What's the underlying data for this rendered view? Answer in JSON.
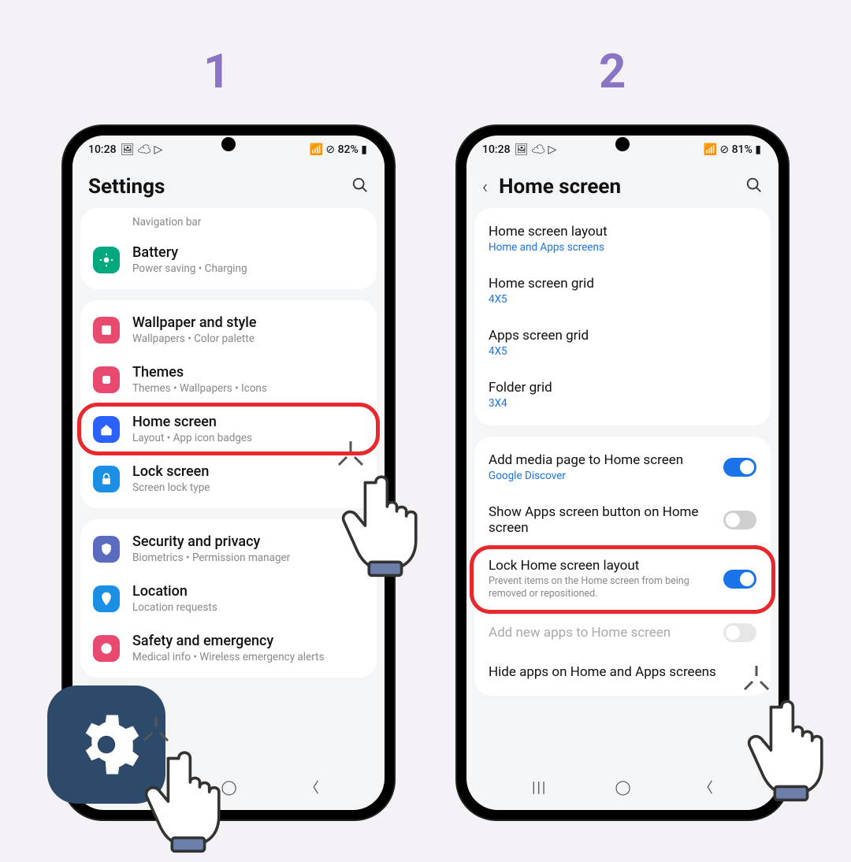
{
  "steps": {
    "one": "1",
    "two": "2"
  },
  "phone1": {
    "status": {
      "time": "10:28",
      "left_icons": "🖼 ☁ ▷",
      "right_icons": "📶 ⊘ 82% ▮"
    },
    "header": {
      "title": "Settings"
    },
    "rows": {
      "nav_trunc": "Navigation bar",
      "battery": {
        "label": "Battery",
        "sub": "Power saving  •  Charging"
      },
      "wallpaper": {
        "label": "Wallpaper and style",
        "sub": "Wallpapers  •  Color palette"
      },
      "themes": {
        "label": "Themes",
        "sub": "Themes  •  Wallpapers  •  Icons"
      },
      "home": {
        "label": "Home screen",
        "sub": "Layout  •  App icon badges"
      },
      "lock": {
        "label": "Lock screen",
        "sub": "Screen lock type"
      },
      "security": {
        "label": "Security and privacy",
        "sub": "Biometrics  •  Permission manager"
      },
      "location": {
        "label": "Location",
        "sub": "Location requests"
      },
      "safety": {
        "label": "Safety and emergency",
        "sub": "Medical info  •  Wireless emergency alerts"
      }
    }
  },
  "phone2": {
    "status": {
      "time": "10:28",
      "left_icons": "🖼 ☁ ▷",
      "right_icons": "📶 ⊘ 81% ▮"
    },
    "header": {
      "title": "Home screen"
    },
    "rows": {
      "layout": {
        "label": "Home screen layout",
        "sub": "Home and Apps screens"
      },
      "hgrid": {
        "label": "Home screen grid",
        "sub": "4X5"
      },
      "agrid": {
        "label": "Apps screen grid",
        "sub": "4X5"
      },
      "fgrid": {
        "label": "Folder grid",
        "sub": "3X4"
      },
      "media": {
        "label": "Add media page to Home screen",
        "sub": "Google Discover"
      },
      "appsbtn": {
        "label": "Show Apps screen button on Home screen"
      },
      "lockhs": {
        "label": "Lock Home screen layout",
        "desc": "Prevent items on the Home screen from being removed or repositioned."
      },
      "addnew": {
        "label": "Add new apps to Home screen"
      },
      "hide": {
        "label": "Hide apps on Home and Apps screens"
      }
    }
  },
  "nav": {
    "recent": "|||",
    "home": "◯",
    "back": "〈"
  }
}
